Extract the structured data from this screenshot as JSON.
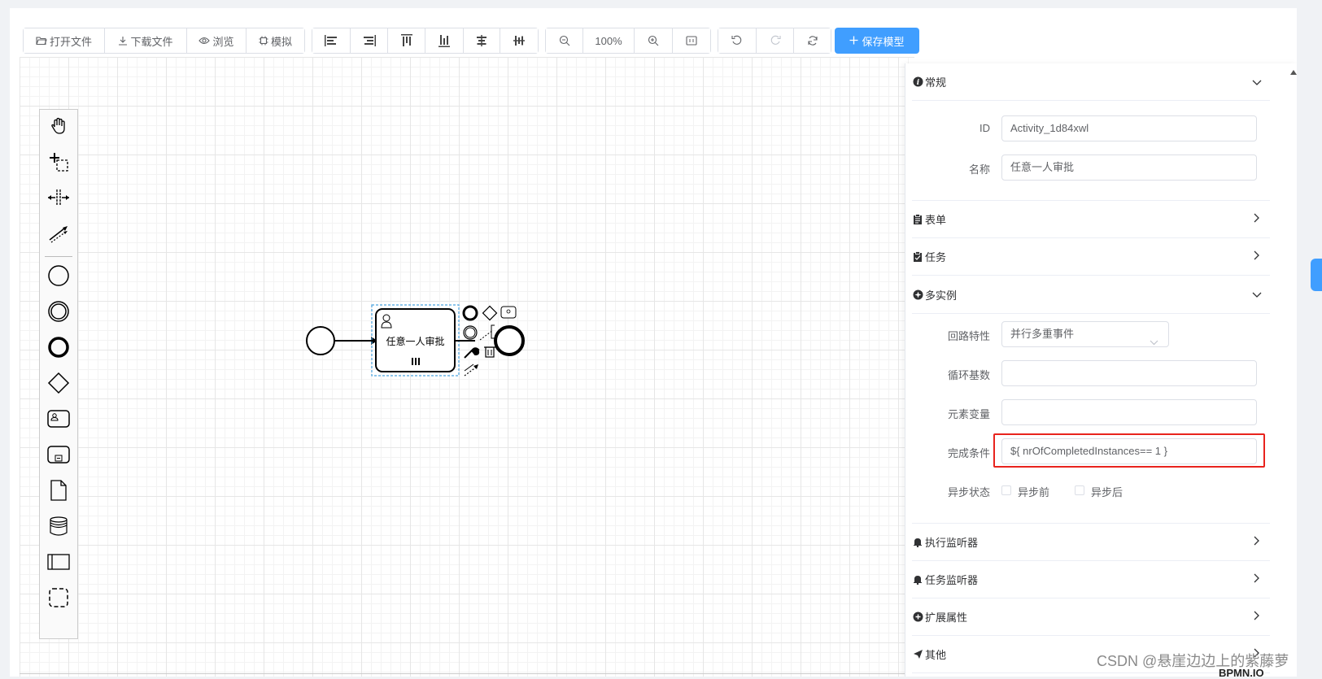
{
  "toolbar": {
    "file_group": [
      {
        "label": "打开文件",
        "icon": "folder-open-icon"
      },
      {
        "label": "下载文件",
        "icon": "download-icon"
      },
      {
        "label": "浏览",
        "icon": "eye-icon"
      },
      {
        "label": "模拟",
        "icon": "chip-icon"
      }
    ],
    "align_group": [
      "align-left-icon",
      "align-right-icon",
      "align-top-icon",
      "align-bottom-icon",
      "align-center-icon",
      "align-middle-icon"
    ],
    "zoom": {
      "out_icon": "zoom-out-icon",
      "level": "100%",
      "in_icon": "zoom-in-icon",
      "fit_icon": "fit-screen-icon"
    },
    "history_group": [
      "undo-icon",
      "redo-icon",
      "refresh-icon"
    ],
    "save_label": "保存模型"
  },
  "palette": [
    "hand-tool-icon",
    "lasso-tool-icon",
    "space-tool-icon",
    "connect-tool-icon",
    "start-event-icon",
    "intermediate-event-icon",
    "end-event-icon",
    "gateway-icon",
    "user-task-icon",
    "subprocess-icon",
    "data-object-icon",
    "data-store-icon",
    "pool-icon",
    "group-icon"
  ],
  "diagram": {
    "task_label": "任意一人审批"
  },
  "panel": {
    "general": {
      "title": "常规",
      "id_label": "ID",
      "id_value": "Activity_1d84xwl",
      "name_label": "名称",
      "name_value": "任意一人审批"
    },
    "form_title": "表单",
    "task_title": "任务",
    "multi": {
      "title": "多实例",
      "loop_label": "回路特性",
      "loop_value": "并行多重事件",
      "cardinality_label": "循环基数",
      "cardinality_value": "",
      "element_var_label": "元素变量",
      "element_var_value": "",
      "completion_label": "完成条件",
      "completion_value": "${ nrOfCompletedInstances== 1 }",
      "async_label": "异步状态",
      "async_before": "异步前",
      "async_after": "异步后"
    },
    "exec_listener_title": "执行监听器",
    "task_listener_title": "任务监听器",
    "ext_props_title": "扩展属性",
    "other_title": "其他"
  },
  "watermark": "CSDN @悬崖边边上的紫藤萝",
  "bottom_partial": "BPMN.IO"
}
